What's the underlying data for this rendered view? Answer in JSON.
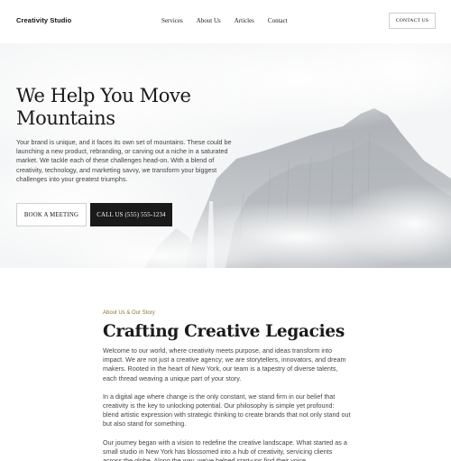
{
  "header": {
    "brand": "Creativity Studio",
    "nav": [
      "Services",
      "About Us",
      "Articles",
      "Contact"
    ],
    "cta": "CONTACT US"
  },
  "hero": {
    "title": "We Help You Move Mountains",
    "description": "Your brand is unique, and it faces its own set of mountains. These could be launching a new product, rebranding, or carving out a niche in a saturated market. We tackle each of these challenges head-on. With a blend of creativity, technology, and marketing savvy, we transform your biggest challenges into your greatest triumphs.",
    "primary_button": "BOOK A MEETING",
    "secondary_button": "CALL US (555) 555-1234",
    "background_image": "misty-mountain-cliff-with-waterfall"
  },
  "about": {
    "eyebrow": "About Us & Our Story",
    "title": "Crafting Creative Legacies",
    "paragraphs": [
      "Welcome to our world, where creativity meets purpose, and ideas transform into impact. We are not just a creative agency; we are storytellers, innovators, and dream makers. Rooted in the heart of New York, our team is a tapestry of diverse talents, each thread weaving a unique part of your story.",
      "In a digital age where change is the only constant, we stand firm in our belief that creativity is the key to unlocking potential. Our philosophy is simple yet profound: blend artistic expression with strategic thinking to create brands that not only stand out but also stand for something.",
      "Our journey began with a vision to redefine the creative landscape. What started as a small studio in New York has blossomed into a hub of creativity, servicing clients across the globe. Along the way, we've helped start-ups find their voice,"
    ]
  },
  "colors": {
    "accent": "#8a7a2e",
    "dark_button": "#1a1a1a",
    "text": "#444444"
  }
}
